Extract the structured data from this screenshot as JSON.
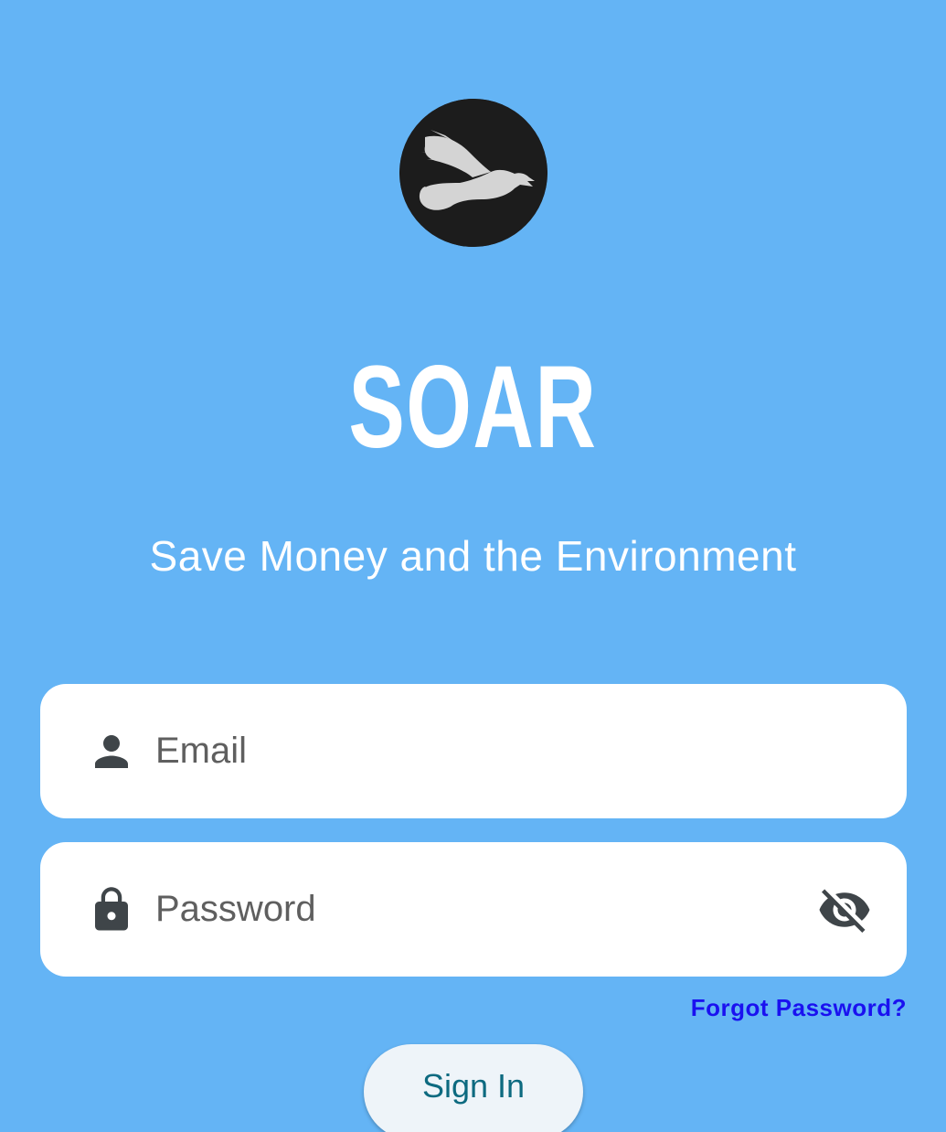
{
  "app": {
    "title": "SOAR",
    "tagline": "Save Money and the Environment",
    "background_color": "#64b4f5"
  },
  "logo": {
    "icon": "bird-logo-icon",
    "background_color": "#1c1c1c",
    "bird_color": "#d4d4d4"
  },
  "email_field": {
    "icon": "person-icon",
    "value": "",
    "placeholder": "Email"
  },
  "password_field": {
    "icon": "lock-icon",
    "value": "",
    "placeholder": "Password",
    "visibility_icon": "eye-off-icon"
  },
  "forgot_password": {
    "label": "Forgot Password?",
    "color": "#1a11f0"
  },
  "sign_in_button": {
    "label": "Sign In",
    "text_color": "#0d6a80"
  }
}
